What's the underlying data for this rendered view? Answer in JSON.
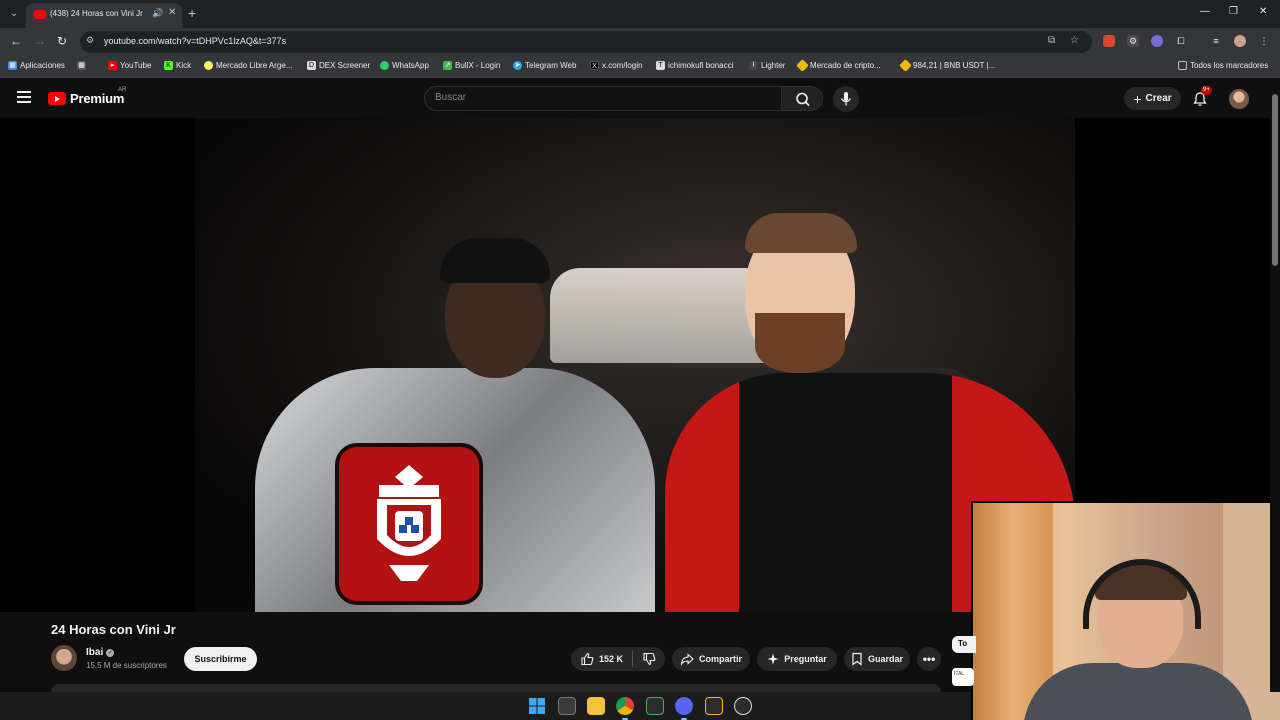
{
  "browser": {
    "tab": {
      "title": "(438) 24 Horas con Vini Jr",
      "audio_icon": "speaker-icon",
      "close_glyph": "✕"
    },
    "new_tab_glyph": "+",
    "window_controls": [
      "—",
      "❐",
      "✕"
    ],
    "url": "youtube.com/watch?v=tDHPVc1lzAQ&t=377s",
    "bookmarks": [
      {
        "label": "Aplicaciones",
        "icon": "apps-grid-icon",
        "color": "#4285f4"
      },
      {
        "label": "",
        "icon": "grid-icon",
        "color": "#888888"
      },
      {
        "label": "YouTube",
        "icon": "youtube-icon",
        "color": "#ff0000"
      },
      {
        "label": "Kick",
        "icon": "kick-icon",
        "color": "#53fc18"
      },
      {
        "label": "Mercado Libre Arge...",
        "icon": "mercadolibre-icon",
        "color": "#fff159"
      },
      {
        "label": "DEX Screener",
        "icon": "dexscreener-icon",
        "color": "#dddddd"
      },
      {
        "label": "WhatsApp",
        "icon": "whatsapp-icon",
        "color": "#25d366"
      },
      {
        "label": "BullX - Login",
        "icon": "bullx-icon",
        "color": "#3fb950"
      },
      {
        "label": "Telegram Web",
        "icon": "telegram-icon",
        "color": "#2aabee"
      },
      {
        "label": "x.com/login",
        "icon": "x-icon",
        "color": "#ffffff"
      },
      {
        "label": "ichimokufi bonacci",
        "icon": "tradingview-icon",
        "color": "#dddddd"
      },
      {
        "label": "Lighter",
        "icon": "lighter-icon",
        "color": "#eeeeee"
      },
      {
        "label": "Mercado de cripto...",
        "icon": "binance-icon",
        "color": "#f0b90b"
      },
      {
        "label": "984,21 | BNB USDT |...",
        "icon": "binance-icon",
        "color": "#f0b90b"
      }
    ],
    "all_bookmarks": "Todos los marcadores"
  },
  "youtube": {
    "logo_text": "Premium",
    "region": "AR",
    "search_placeholder": "Buscar",
    "create_label": "Crear",
    "notifications_badge": "9+",
    "video": {
      "title": "24 Horas con Vini Jr",
      "channel": "Ibai",
      "subscribers": "15,5 M de suscriptores",
      "subscribe_label": "Suscribirme",
      "likes": "152 K",
      "share_label": "Compartir",
      "ask_label": "Preguntar",
      "save_label": "Guardar"
    },
    "side_chip": "To",
    "side_thumb_text": "ITAL"
  },
  "colors": {
    "youtube_red": "#ff0000",
    "background": "#0f0f0f",
    "pill": "#272727"
  }
}
